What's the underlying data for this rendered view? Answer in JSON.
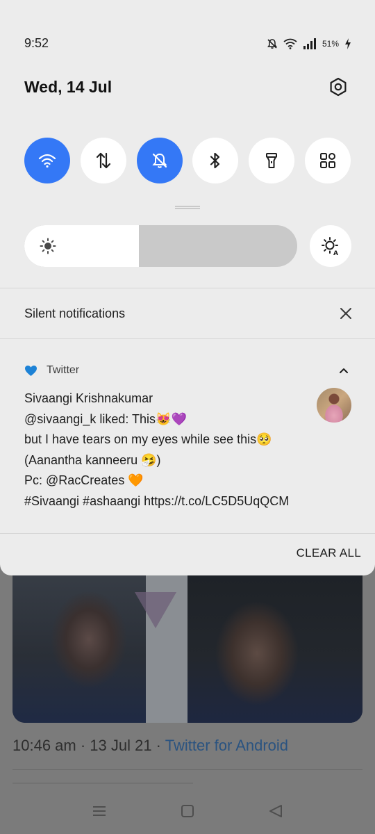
{
  "status_bar": {
    "time": "9:52",
    "battery": "51%"
  },
  "header": {
    "date": "Wed, 14 Jul"
  },
  "quick_tiles": [
    {
      "name": "wifi",
      "active": true
    },
    {
      "name": "mobile-data",
      "active": false
    },
    {
      "name": "do-not-disturb",
      "active": true
    },
    {
      "name": "bluetooth",
      "active": false
    },
    {
      "name": "flashlight",
      "active": false
    },
    {
      "name": "more-tiles",
      "active": false
    }
  ],
  "brightness": {
    "level": 0.42
  },
  "silent_section": {
    "title": "Silent notifications"
  },
  "notification": {
    "app_name": "Twitter",
    "lines": [
      "Sivaangi Krishnakumar",
      "@sivaangi_k liked: This😻💜",
      "but I have tears on my eyes while see this🥺",
      "(Aanantha kanneeru 🤧)",
      "Pc: @RacCreates 🧡",
      "#Sivaangi #ashaangi https://t.co/LC5D5UqQCM"
    ]
  },
  "clear_all": "CLEAR ALL",
  "background_app": {
    "timestamp": "10:46 am · 13 Jul 21 · ",
    "source": "Twitter for Android"
  },
  "colors": {
    "accent": "#3478f6",
    "shade_bg": "#ececec"
  }
}
